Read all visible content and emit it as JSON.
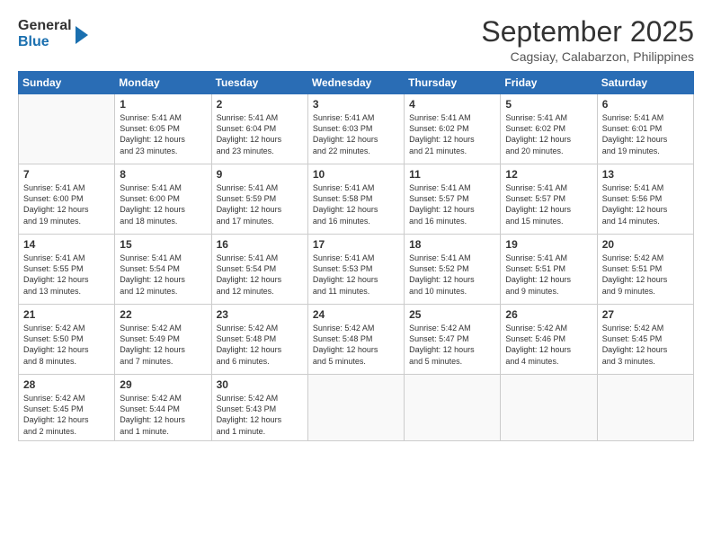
{
  "logo": {
    "line1": "General",
    "line2": "Blue"
  },
  "title": "September 2025",
  "subtitle": "Cagsiay, Calabarzon, Philippines",
  "header_days": [
    "Sunday",
    "Monday",
    "Tuesday",
    "Wednesday",
    "Thursday",
    "Friday",
    "Saturday"
  ],
  "weeks": [
    [
      {
        "day": "",
        "info": ""
      },
      {
        "day": "1",
        "info": "Sunrise: 5:41 AM\nSunset: 6:05 PM\nDaylight: 12 hours\nand 23 minutes."
      },
      {
        "day": "2",
        "info": "Sunrise: 5:41 AM\nSunset: 6:04 PM\nDaylight: 12 hours\nand 23 minutes."
      },
      {
        "day": "3",
        "info": "Sunrise: 5:41 AM\nSunset: 6:03 PM\nDaylight: 12 hours\nand 22 minutes."
      },
      {
        "day": "4",
        "info": "Sunrise: 5:41 AM\nSunset: 6:02 PM\nDaylight: 12 hours\nand 21 minutes."
      },
      {
        "day": "5",
        "info": "Sunrise: 5:41 AM\nSunset: 6:02 PM\nDaylight: 12 hours\nand 20 minutes."
      },
      {
        "day": "6",
        "info": "Sunrise: 5:41 AM\nSunset: 6:01 PM\nDaylight: 12 hours\nand 19 minutes."
      }
    ],
    [
      {
        "day": "7",
        "info": "Sunrise: 5:41 AM\nSunset: 6:00 PM\nDaylight: 12 hours\nand 19 minutes."
      },
      {
        "day": "8",
        "info": "Sunrise: 5:41 AM\nSunset: 6:00 PM\nDaylight: 12 hours\nand 18 minutes."
      },
      {
        "day": "9",
        "info": "Sunrise: 5:41 AM\nSunset: 5:59 PM\nDaylight: 12 hours\nand 17 minutes."
      },
      {
        "day": "10",
        "info": "Sunrise: 5:41 AM\nSunset: 5:58 PM\nDaylight: 12 hours\nand 16 minutes."
      },
      {
        "day": "11",
        "info": "Sunrise: 5:41 AM\nSunset: 5:57 PM\nDaylight: 12 hours\nand 16 minutes."
      },
      {
        "day": "12",
        "info": "Sunrise: 5:41 AM\nSunset: 5:57 PM\nDaylight: 12 hours\nand 15 minutes."
      },
      {
        "day": "13",
        "info": "Sunrise: 5:41 AM\nSunset: 5:56 PM\nDaylight: 12 hours\nand 14 minutes."
      }
    ],
    [
      {
        "day": "14",
        "info": "Sunrise: 5:41 AM\nSunset: 5:55 PM\nDaylight: 12 hours\nand 13 minutes."
      },
      {
        "day": "15",
        "info": "Sunrise: 5:41 AM\nSunset: 5:54 PM\nDaylight: 12 hours\nand 12 minutes."
      },
      {
        "day": "16",
        "info": "Sunrise: 5:41 AM\nSunset: 5:54 PM\nDaylight: 12 hours\nand 12 minutes."
      },
      {
        "day": "17",
        "info": "Sunrise: 5:41 AM\nSunset: 5:53 PM\nDaylight: 12 hours\nand 11 minutes."
      },
      {
        "day": "18",
        "info": "Sunrise: 5:41 AM\nSunset: 5:52 PM\nDaylight: 12 hours\nand 10 minutes."
      },
      {
        "day": "19",
        "info": "Sunrise: 5:41 AM\nSunset: 5:51 PM\nDaylight: 12 hours\nand 9 minutes."
      },
      {
        "day": "20",
        "info": "Sunrise: 5:42 AM\nSunset: 5:51 PM\nDaylight: 12 hours\nand 9 minutes."
      }
    ],
    [
      {
        "day": "21",
        "info": "Sunrise: 5:42 AM\nSunset: 5:50 PM\nDaylight: 12 hours\nand 8 minutes."
      },
      {
        "day": "22",
        "info": "Sunrise: 5:42 AM\nSunset: 5:49 PM\nDaylight: 12 hours\nand 7 minutes."
      },
      {
        "day": "23",
        "info": "Sunrise: 5:42 AM\nSunset: 5:48 PM\nDaylight: 12 hours\nand 6 minutes."
      },
      {
        "day": "24",
        "info": "Sunrise: 5:42 AM\nSunset: 5:48 PM\nDaylight: 12 hours\nand 5 minutes."
      },
      {
        "day": "25",
        "info": "Sunrise: 5:42 AM\nSunset: 5:47 PM\nDaylight: 12 hours\nand 5 minutes."
      },
      {
        "day": "26",
        "info": "Sunrise: 5:42 AM\nSunset: 5:46 PM\nDaylight: 12 hours\nand 4 minutes."
      },
      {
        "day": "27",
        "info": "Sunrise: 5:42 AM\nSunset: 5:45 PM\nDaylight: 12 hours\nand 3 minutes."
      }
    ],
    [
      {
        "day": "28",
        "info": "Sunrise: 5:42 AM\nSunset: 5:45 PM\nDaylight: 12 hours\nand 2 minutes."
      },
      {
        "day": "29",
        "info": "Sunrise: 5:42 AM\nSunset: 5:44 PM\nDaylight: 12 hours\nand 1 minute."
      },
      {
        "day": "30",
        "info": "Sunrise: 5:42 AM\nSunset: 5:43 PM\nDaylight: 12 hours\nand 1 minute."
      },
      {
        "day": "",
        "info": ""
      },
      {
        "day": "",
        "info": ""
      },
      {
        "day": "",
        "info": ""
      },
      {
        "day": "",
        "info": ""
      }
    ]
  ]
}
